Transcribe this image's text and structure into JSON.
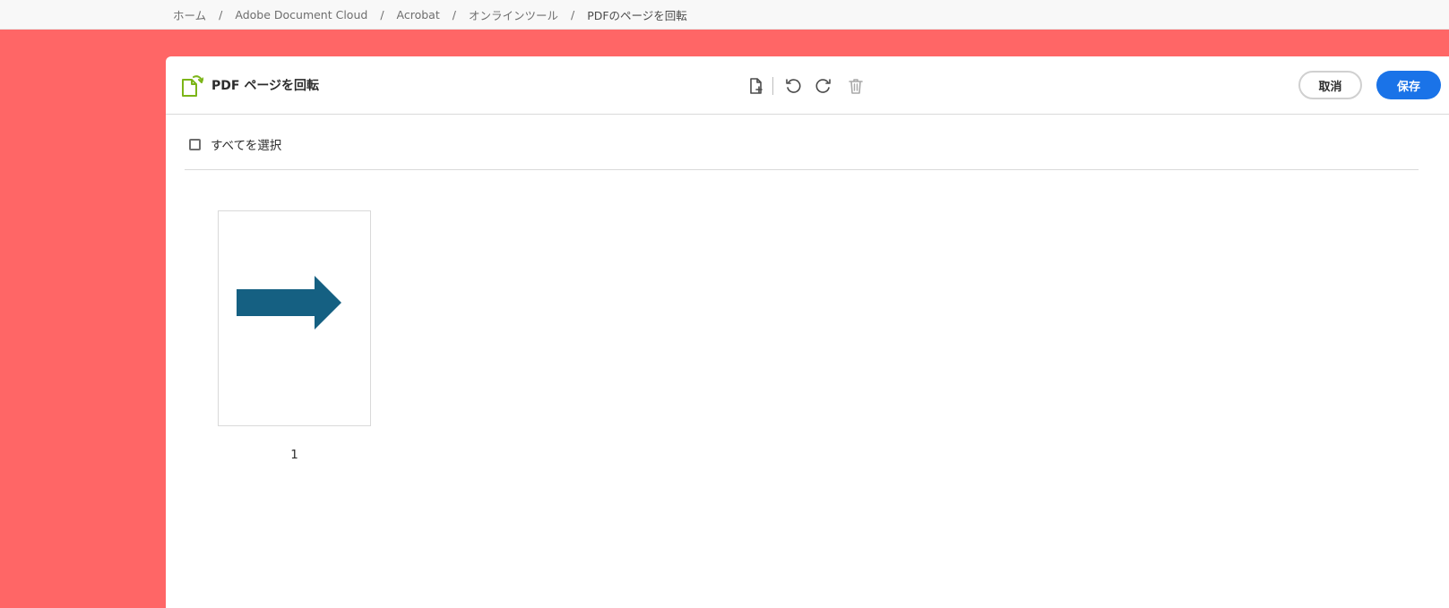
{
  "breadcrumb": {
    "items": [
      "ホーム",
      "Adobe Document Cloud",
      "Acrobat",
      "オンラインツール",
      "PDFのページを回転"
    ],
    "separator": "/"
  },
  "tool": {
    "title": "PDF ページを回転",
    "icon": "rotate-page-icon"
  },
  "toolbar": {
    "insert_icon": "insert-page-icon",
    "rotate_left_icon": "rotate-counterclockwise-icon",
    "rotate_right_icon": "rotate-clockwise-icon",
    "delete_icon": "trash-icon"
  },
  "actions": {
    "cancel_label": "取消",
    "save_label": "保存"
  },
  "selection": {
    "select_all_label": "すべてを選択",
    "checked": false
  },
  "pages": [
    {
      "number": "1",
      "content": "right-arrow-shape"
    }
  ],
  "colors": {
    "background_band": "#ff6666",
    "primary_button": "#1a73e8",
    "tool_icon_green": "#7cb518",
    "arrow_fill": "#156082"
  }
}
